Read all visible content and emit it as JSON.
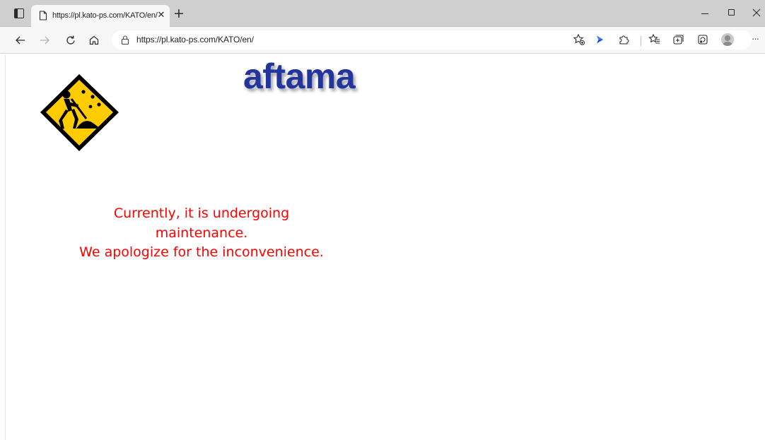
{
  "browser": {
    "tab": {
      "title": "https://pl.kato-ps.com/KATO/en/",
      "close_glyph": "✕",
      "favicon": "page-icon"
    },
    "new_tab_glyph": "+",
    "address_bar": {
      "url": "https://pl.kato-ps.com/KATO/en/",
      "security_icon": "lock-icon"
    },
    "toolbar_icons": [
      "back-icon",
      "forward-icon",
      "refresh-icon",
      "home-icon",
      "add-favorite-icon",
      "bing-chevron-icon",
      "extensions-icon",
      "favorites-icon",
      "collections-icon",
      "browser-essentials-icon",
      "profile-avatar"
    ],
    "more_glyph": "···",
    "window_controls": [
      "minimize",
      "maximize",
      "close"
    ]
  },
  "page": {
    "logo_text": "aftama",
    "logo_color": "#23349a",
    "message_lines": [
      "Currently, it is undergoing",
      "maintenance.",
      "We apologize for the inconvenience."
    ],
    "message_color": "#ff0000",
    "sign_icon": "under-construction-icon",
    "sign_color": "#ffcc00"
  }
}
